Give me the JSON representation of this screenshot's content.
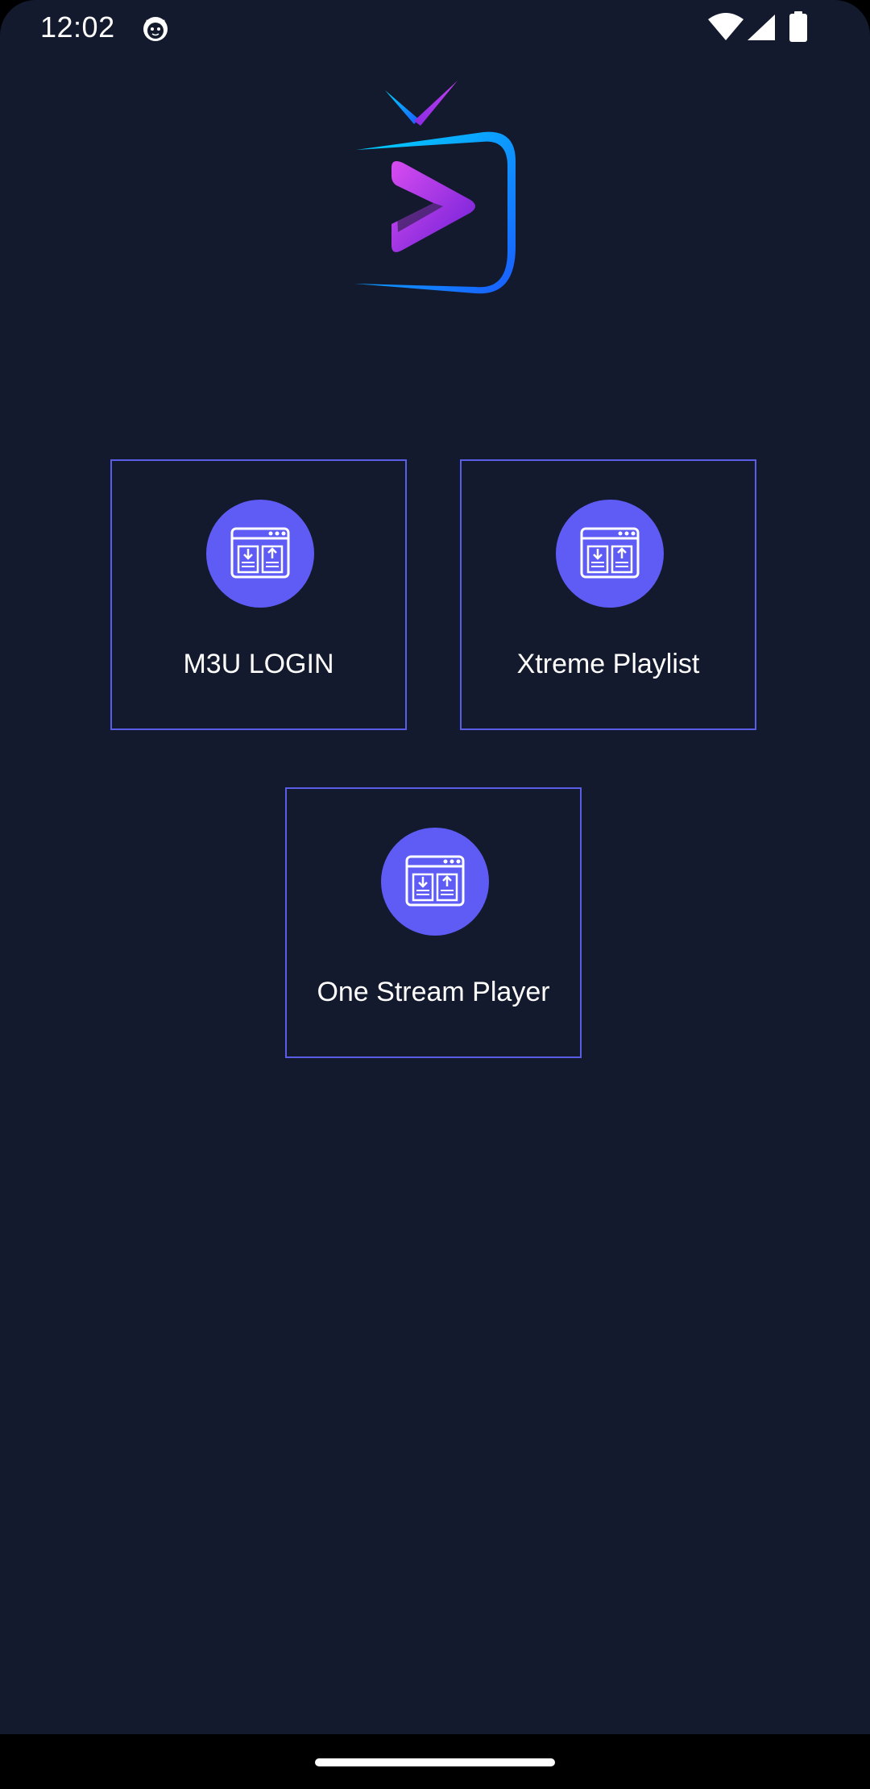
{
  "status_bar": {
    "time": "12:02",
    "icons": [
      "cat-icon",
      "wifi-icon",
      "signal-icon",
      "battery-icon"
    ]
  },
  "logo": {
    "icon": "tv-play-logo-icon",
    "colors": {
      "gradient_start": "#00c8ff",
      "gradient_end": "#b53cf5",
      "frame": "#1a6bff"
    }
  },
  "menu": {
    "items": [
      {
        "label": "M3U LOGIN",
        "icon": "playlist-transfer-icon"
      },
      {
        "label": "Xtreme Playlist",
        "icon": "playlist-transfer-icon"
      },
      {
        "label": "One Stream Player",
        "icon": "playlist-transfer-icon"
      }
    ]
  },
  "colors": {
    "background": "#141a2e",
    "accent": "#5e5cf5",
    "tile_border": "#5a5ee6",
    "text": "#ffffff",
    "nav_bar": "#000000"
  }
}
